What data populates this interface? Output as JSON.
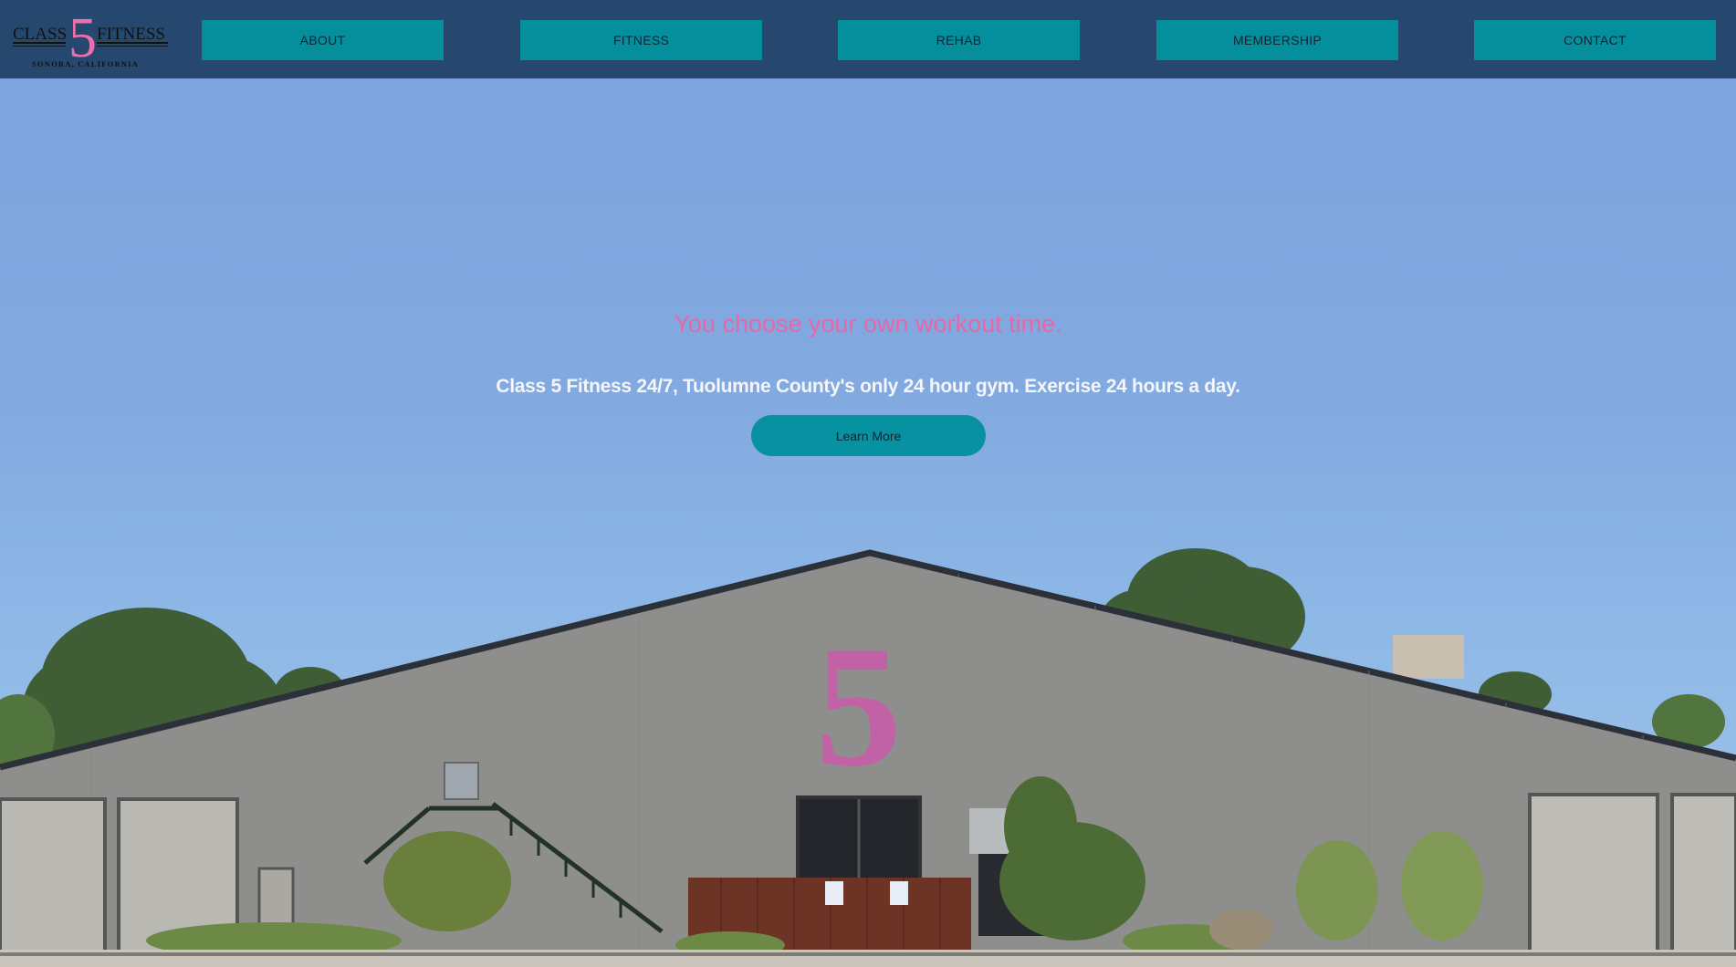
{
  "brand": {
    "logo_line1_left": "CLASS",
    "logo_number": "5",
    "logo_line1_right": "FITNESS",
    "logo_tagline": "SONORA, CALIFORNIA"
  },
  "nav": {
    "items": [
      {
        "label": "ABOUT"
      },
      {
        "label": "FITNESS"
      },
      {
        "label": "REHAB"
      },
      {
        "label": "MEMBERSHIP"
      },
      {
        "label": "CONTACT"
      }
    ]
  },
  "hero": {
    "headline": "You choose your own workout time.",
    "subline": "Class 5 Fitness 24/7, Tuolumne County's only 24 hour gym. Exercise 24 hours a day.",
    "cta_label": "Learn More",
    "building_numeral": "5"
  },
  "colors": {
    "header_bg": "#26486e",
    "nav_button": "#058f9c",
    "accent_pink": "#e967a6",
    "sky": "#82a9e0"
  }
}
